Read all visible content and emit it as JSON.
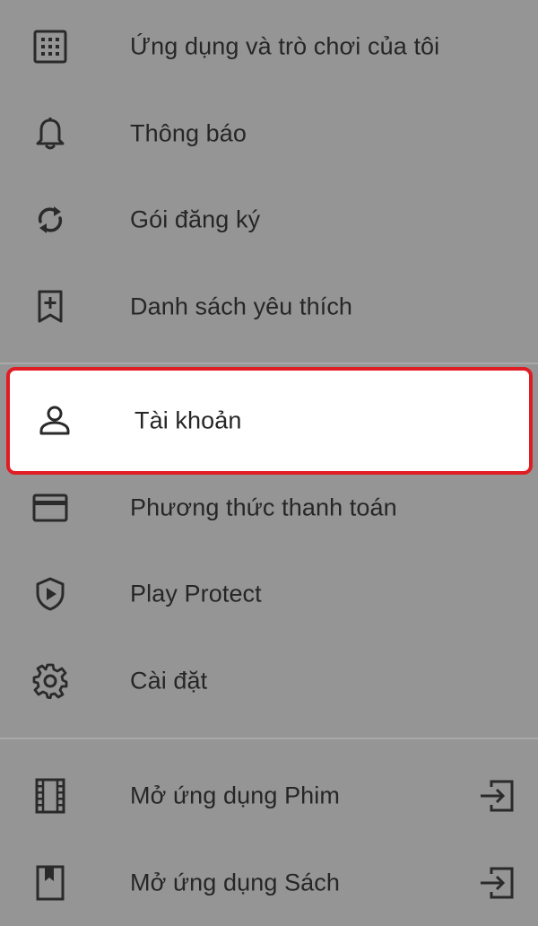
{
  "menu": {
    "items": [
      {
        "label": "Ứng dụng và trò chơi của tôi",
        "icon": "apps-grid-icon"
      },
      {
        "label": "Thông báo",
        "icon": "bell-icon"
      },
      {
        "label": "Gói đăng ký",
        "icon": "refresh-icon"
      },
      {
        "label": "Danh sách yêu thích",
        "icon": "bookmark-add-icon"
      },
      {
        "label": "Tài khoản",
        "icon": "person-icon",
        "highlighted": true
      },
      {
        "label": "Phương thức thanh toán",
        "icon": "credit-card-icon"
      },
      {
        "label": "Play Protect",
        "icon": "shield-play-icon"
      },
      {
        "label": "Cài đặt",
        "icon": "gear-icon"
      },
      {
        "label": "Mở ứng dụng Phim",
        "icon": "film-icon",
        "trailing_icon": "open-app-icon"
      },
      {
        "label": "Mở ứng dụng Sách",
        "icon": "book-icon",
        "trailing_icon": "open-app-icon"
      }
    ]
  },
  "colors": {
    "background": "#959595",
    "text": "#262626",
    "icon": "#2a2a2a",
    "highlight_border": "#e01c24",
    "highlight_fill": "#ffffff",
    "divider": "#a9a9a9"
  }
}
